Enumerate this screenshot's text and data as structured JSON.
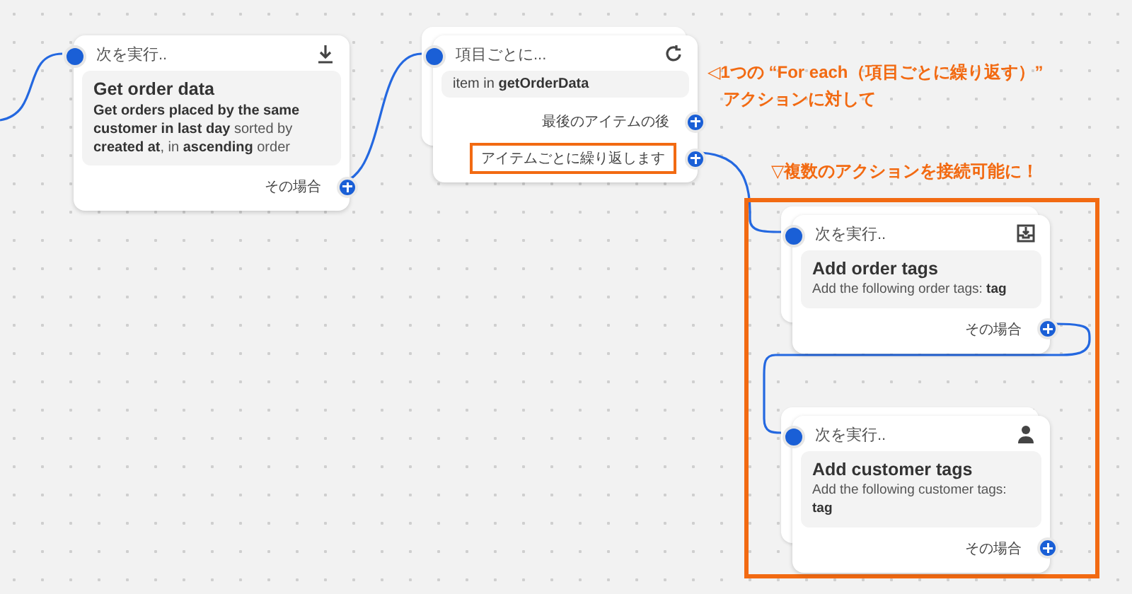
{
  "nodes": [
    {
      "kind": "action",
      "header": "次を実行..",
      "title": "Get order data",
      "description": "**Get orders placed by the same customer in last day** sorted by **created at**, in **ascending** order",
      "footer": "その場合"
    },
    {
      "kind": "loop",
      "header": "項目ごとに...",
      "expression": "item in **getOrderData**",
      "branches": [
        {
          "label": "最後のアイテムの後",
          "highlighted": false
        },
        {
          "label": "アイテムごとに繰り返します",
          "highlighted": true
        }
      ]
    },
    {
      "kind": "action",
      "header": "次を実行..",
      "title": "Add order tags",
      "description": "Add the following order tags: **tag**",
      "footer": "その場合"
    },
    {
      "kind": "action",
      "header": "次を実行..",
      "title": "Add customer tags",
      "description": "Add the following customer tags: **tag**",
      "footer": "その場合"
    }
  ],
  "annotations": [
    {
      "lines": [
        "◁1つの “For each（項目ごとに繰り返す）”",
        "アクションに対して"
      ]
    },
    {
      "lines": [
        "▽複数のアクションを接続可能に！"
      ]
    }
  ]
}
